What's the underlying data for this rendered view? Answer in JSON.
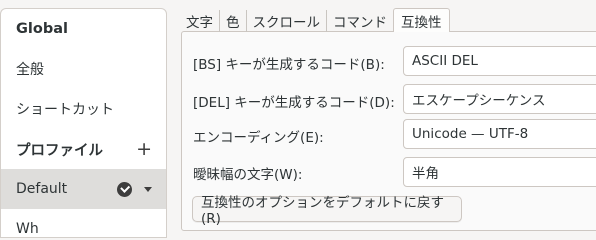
{
  "sidebar": {
    "items": [
      {
        "label": "Global"
      },
      {
        "label": "全般"
      },
      {
        "label": "ショートカット"
      },
      {
        "label": "プロファイル",
        "action": "+"
      },
      {
        "label": "Default"
      },
      {
        "label": "Wh"
      }
    ]
  },
  "tabs": [
    {
      "label": "文字"
    },
    {
      "label": "色"
    },
    {
      "label": "スクロール"
    },
    {
      "label": "コマンド"
    },
    {
      "label": "互換性",
      "active": true
    }
  ],
  "settings": [
    {
      "label": "[BS] キーが生成するコード(B):",
      "value": "ASCII DEL"
    },
    {
      "label": "[DEL] キーが生成するコード(D):",
      "value": "エスケープシーケンス"
    },
    {
      "label": "エンコーディング(E):",
      "value": "Unicode — UTF-8"
    },
    {
      "label": "曖昧幅の文字(W):",
      "value": "半角"
    }
  ],
  "reset_button": "互換性のオプションをデフォルトに戻す(R)",
  "colors": {
    "window_bg": "#f6f5f4",
    "selected_row": "#dedddb",
    "border": "#cdc7c2"
  }
}
